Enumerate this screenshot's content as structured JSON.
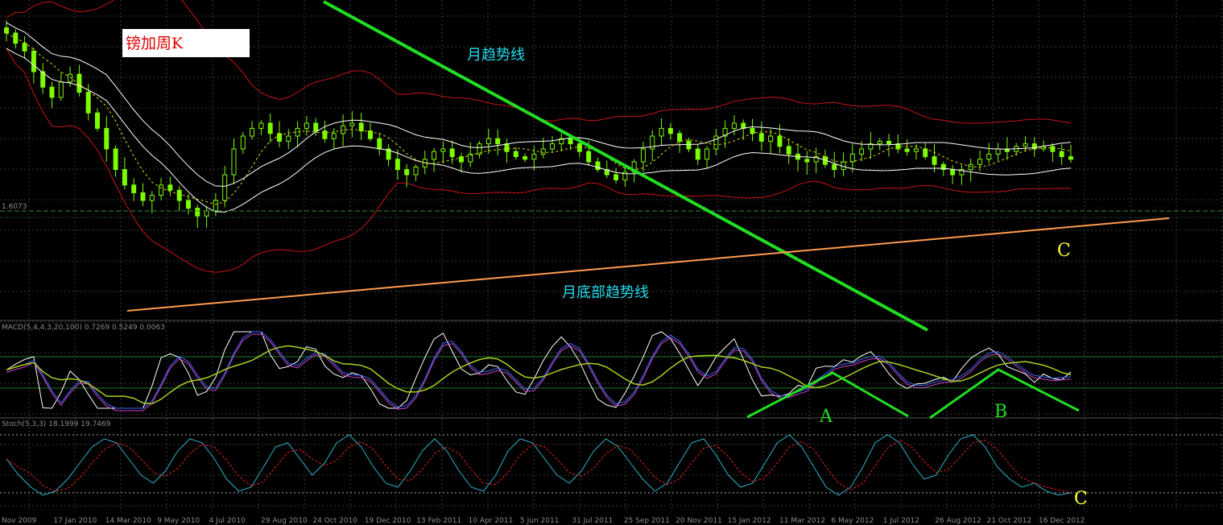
{
  "title": "镑加周K",
  "annotations": {
    "monthly_trendline": "月趋势线",
    "monthly_bottom_trendline": "月底部趋势线",
    "point_a": "A",
    "point_b": "B",
    "point_c": "C"
  },
  "colors": {
    "background": "#000000",
    "grid": "#3a3a3a",
    "candle": "#7cfc00",
    "bollinger": "#c81414",
    "ma_white": "#ffffff",
    "ma_dashed": "#d8d800",
    "trend_down": "#22dd22",
    "trend_up": "#ff9a50",
    "annotation_text": "#22ddee",
    "label_c": "#ffff33",
    "pattern_lines": "#22dd22"
  },
  "chart_data": [
    {
      "type": "candlestick",
      "title": "镑加周K",
      "price_label": "1.6073",
      "x_tick_labels": [
        "Nov 2009",
        "17 Jan 2010",
        "14 Mar 2010",
        "9 May 2010",
        "4 Jul 2010",
        "29 Aug 2010",
        "24 Oct 2010",
        "19 Dec 2010",
        "13 Feb 2011",
        "10 Apr 2011",
        "5 Jun 2011",
        "31 Jul 2011",
        "25 Sep 2011",
        "20 Nov 2011",
        "15 Jan 2012",
        "11 Mar 2012",
        "6 May 2012",
        "1 Jul 2012",
        "26 Aug 2012",
        "21 Oct 2012",
        "16 Dec 2012"
      ],
      "close_relative": [
        0.95,
        0.91,
        0.88,
        0.8,
        0.74,
        0.7,
        0.76,
        0.79,
        0.72,
        0.64,
        0.58,
        0.5,
        0.42,
        0.36,
        0.33,
        0.3,
        0.32,
        0.36,
        0.34,
        0.3,
        0.27,
        0.24,
        0.26,
        0.3,
        0.4,
        0.5,
        0.55,
        0.58,
        0.6,
        0.56,
        0.53,
        0.55,
        0.58,
        0.6,
        0.57,
        0.54,
        0.56,
        0.59,
        0.6,
        0.57,
        0.54,
        0.5,
        0.46,
        0.42,
        0.4,
        0.43,
        0.46,
        0.49,
        0.5,
        0.47,
        0.45,
        0.48,
        0.52,
        0.54,
        0.52,
        0.49,
        0.47,
        0.46,
        0.48,
        0.5,
        0.52,
        0.54,
        0.52,
        0.49,
        0.45,
        0.42,
        0.4,
        0.38,
        0.41,
        0.45,
        0.5,
        0.55,
        0.58,
        0.56,
        0.53,
        0.5,
        0.46,
        0.5,
        0.55,
        0.58,
        0.6,
        0.58,
        0.56,
        0.53,
        0.55,
        0.51,
        0.48,
        0.46,
        0.45,
        0.47,
        0.44,
        0.42,
        0.45,
        0.48,
        0.5,
        0.52,
        0.53,
        0.52,
        0.5,
        0.49,
        0.5,
        0.47,
        0.44,
        0.42,
        0.4,
        0.42,
        0.44,
        0.46,
        0.48,
        0.5,
        0.49,
        0.51,
        0.52,
        0.5,
        0.51,
        0.49,
        0.47,
        0.46
      ],
      "lower_indicator_label": "MACD(5,4,4,3,20,100) 0.7269 0.5249 0.0063",
      "stoch_label": "Stoch(5,3,3) 18.1999 19.7469"
    },
    {
      "type": "line",
      "name": "Stochastic (5,3,3)",
      "ylim": [
        0,
        100
      ],
      "main_relative": [
        60,
        40,
        25,
        15,
        20,
        35,
        55,
        75,
        85,
        80,
        60,
        40,
        30,
        45,
        70,
        85,
        80,
        60,
        35,
        20,
        25,
        50,
        75,
        80,
        60,
        40,
        55,
        80,
        90,
        75,
        50,
        30,
        25,
        45,
        70,
        85,
        70,
        45,
        25,
        20,
        40,
        70,
        85,
        80,
        60,
        40,
        30,
        45,
        70,
        85,
        75,
        55,
        35,
        20,
        30,
        55,
        80,
        85,
        65,
        40,
        25,
        30,
        55,
        80,
        90,
        75,
        50,
        25,
        15,
        25,
        50,
        80,
        90,
        80,
        55,
        35,
        40,
        65,
        85,
        90,
        75,
        50,
        35,
        25,
        30,
        20,
        15,
        18
      ]
    }
  ]
}
